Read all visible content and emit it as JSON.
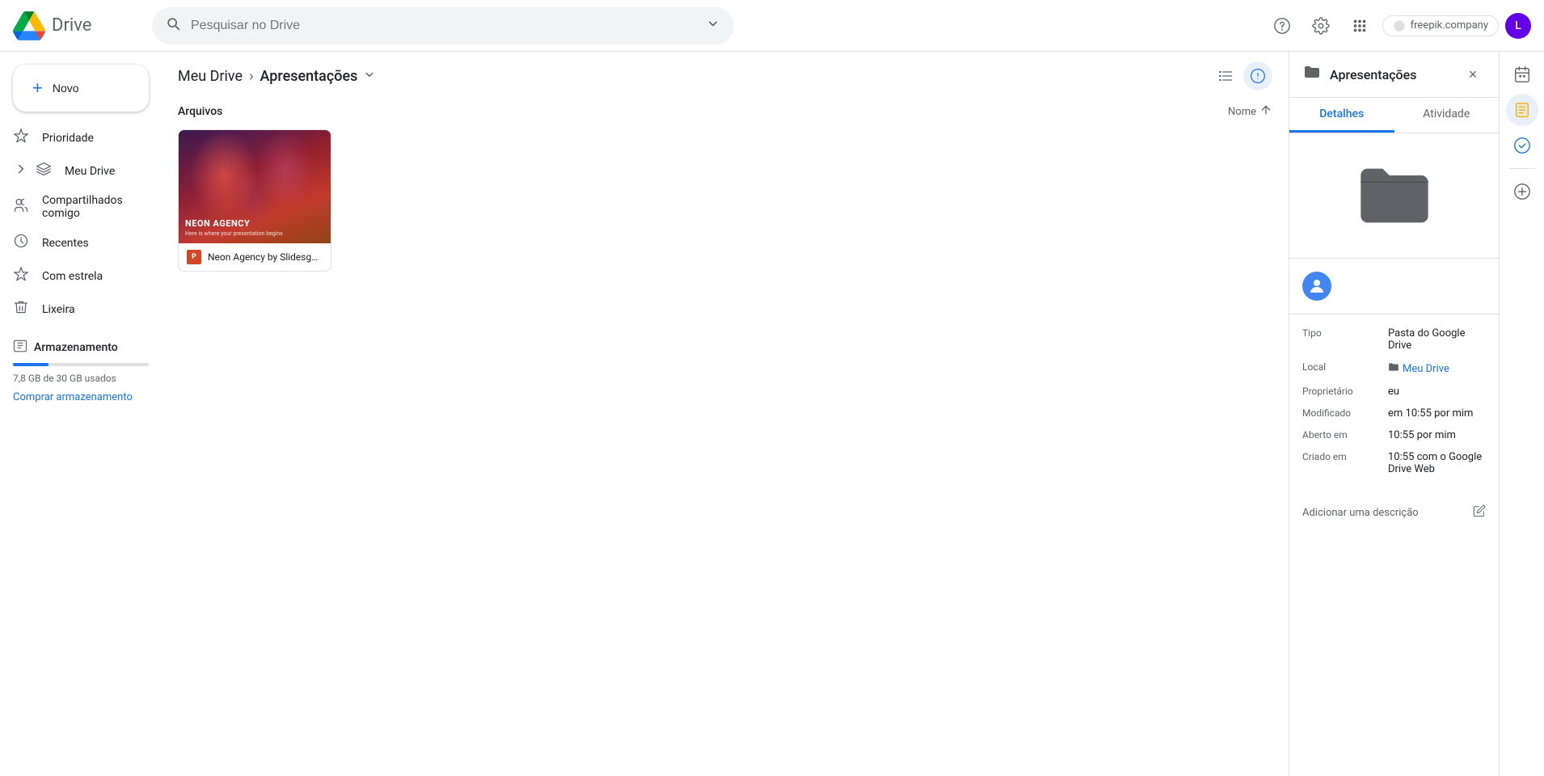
{
  "app": {
    "name": "Drive",
    "logo_alt": "Google Drive"
  },
  "topbar": {
    "search_placeholder": "Pesquisar no Drive",
    "help_icon": "?",
    "settings_icon": "⚙",
    "apps_icon": "⋮⋮⋮",
    "freepik_label": "freepik.company",
    "avatar_letter": "L"
  },
  "sidebar": {
    "new_button": "Novo",
    "nav_items": [
      {
        "id": "priority",
        "label": "Prioridade",
        "icon": "clock"
      },
      {
        "id": "my-drive",
        "label": "Meu Drive",
        "icon": "drive"
      },
      {
        "id": "shared",
        "label": "Compartilhados comigo",
        "icon": "person"
      },
      {
        "id": "recent",
        "label": "Recentes",
        "icon": "recent"
      },
      {
        "id": "starred",
        "label": "Com estrela",
        "icon": "star"
      },
      {
        "id": "trash",
        "label": "Lixeira",
        "icon": "trash"
      }
    ],
    "storage": {
      "section_label": "Armazenamento",
      "used_text": "7,8 GB de 30 GB usados",
      "percent": 26,
      "buy_link": "Comprar armazenamento"
    }
  },
  "breadcrumb": {
    "parent": "Meu Drive",
    "current": "Apresentações"
  },
  "files_section": {
    "title": "Arquivos",
    "sort_label": "Nome",
    "sort_arrow": "↑"
  },
  "file_card": {
    "title": "Neon Agency by Slidesgo....",
    "ppt_label": "P",
    "thumbnail_title": "NEON AGENCY",
    "thumbnail_subtitle": "Here is where your presentation begins"
  },
  "right_panel": {
    "folder_name": "Apresentações",
    "close_icon": "×",
    "tabs": [
      {
        "id": "details",
        "label": "Detalhes"
      },
      {
        "id": "activity",
        "label": "Atividade"
      }
    ],
    "details": {
      "tipo_label": "Tipo",
      "tipo_value": "Pasta do Google Drive",
      "local_label": "Local",
      "local_value": "Meu Drive",
      "proprietario_label": "Proprietário",
      "proprietario_value": "eu",
      "modificado_label": "Modificado",
      "modificado_value": "em 10:55 por mim",
      "aberto_label": "Aberto em",
      "aberto_value": "10:55 por mim",
      "criado_label": "Criado em",
      "criado_value": "10:55 com o Google Drive Web"
    },
    "description_label": "Adicionar uma descrição"
  },
  "mini_sidebar": {
    "icons": [
      "calendar",
      "note",
      "check",
      "plus"
    ]
  },
  "colors": {
    "accent_blue": "#1a73e8",
    "folder_dark": "#5f6368",
    "storage_bar": "#1a73e8"
  }
}
